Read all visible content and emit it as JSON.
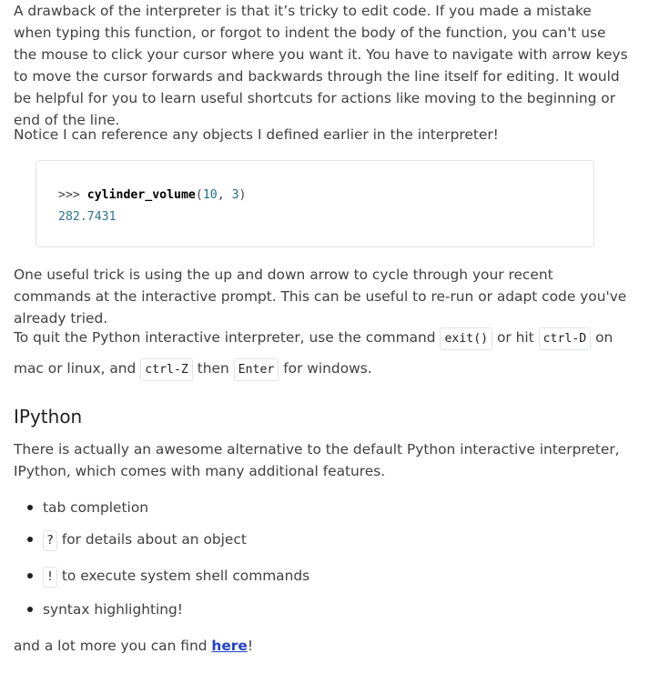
{
  "paragraphs": {
    "p1": "A drawback of the interpreter is that it’s tricky to edit code. If you made a mistake when typing this function, or forgot to indent the body of the function, you can't use the mouse to click your cursor where you want it. You have to navigate with arrow keys to move the cursor forwards and backwards through the line itself for editing. It would be helpful for you to learn useful shortcuts for actions like moving to the beginning or end of the line.",
    "p2": "Notice I can reference any objects I defined earlier in the interpreter!",
    "p3": "One useful trick is using the up and down arrow to cycle through your recent commands at the interactive prompt. This can be useful to re-run or adapt code you've already tried.",
    "p4_a": "To quit the Python interactive interpreter, use the command ",
    "p4_code1": "exit()",
    "p4_b": " or hit ",
    "p4_code2": "ctrl-D",
    "p4_c": " on mac or linux, and ",
    "p4_code3": "ctrl-Z",
    "p4_d": " then ",
    "p4_code4": "Enter",
    "p4_e": " for windows.",
    "p5": "There is actually an awesome alternative to the default Python interactive interpreter, IPython, which comes with many additional features.",
    "p6_a": "and a lot more you can find ",
    "p6_link": "here",
    "p6_b": "!"
  },
  "code": {
    "prompt": ">>> ",
    "func": "cylinder_volume",
    "open": "(",
    "arg1": "10",
    "sep": ", ",
    "arg2": "3",
    "close": ")",
    "output": "282.7431"
  },
  "heading": "IPython",
  "list": {
    "item1": "tab completion",
    "item2_code": "?",
    "item2_text": " for details about an object",
    "item3_code": "!",
    "item3_text": " to execute system shell commands",
    "item4": "syntax highlighting!"
  }
}
